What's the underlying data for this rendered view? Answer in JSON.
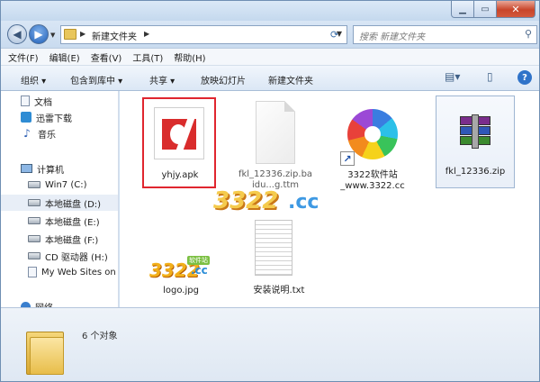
{
  "window": {
    "address_crumb": "新建文件夹",
    "search_placeholder": "搜索 新建文件夹"
  },
  "menu": [
    "文件(F)",
    "编辑(E)",
    "查看(V)",
    "工具(T)",
    "帮助(H)"
  ],
  "toolbar": {
    "organize": "组织 ▾",
    "include_library": "包含到库中 ▾",
    "share": "共享 ▾",
    "slideshow": "放映幻灯片",
    "new_folder": "新建文件夹"
  },
  "nav": {
    "items": [
      {
        "label": "文档",
        "icon": "document-icon"
      },
      {
        "label": "迅雷下载",
        "icon": "thunder-download-icon"
      },
      {
        "label": "音乐",
        "icon": "music-icon"
      },
      {
        "label": "计算机",
        "icon": "computer-icon"
      },
      {
        "label": "Win7 (C:)",
        "icon": "drive-icon"
      },
      {
        "label": "本地磁盘 (D:)",
        "icon": "drive-icon"
      },
      {
        "label": "本地磁盘 (E:)",
        "icon": "drive-icon"
      },
      {
        "label": "本地磁盘 (F:)",
        "icon": "drive-icon"
      },
      {
        "label": "CD 驱动器 (H:)",
        "icon": "cd-drive-icon"
      },
      {
        "label": "My Web Sites on",
        "icon": "web-folder-icon"
      },
      {
        "label": "网络",
        "icon": "network-icon"
      }
    ]
  },
  "files": [
    {
      "name": "yhjy.apk",
      "icon": "apk-file-icon"
    },
    {
      "name": "fkl_12336.zip.ba idu...g.ttm",
      "icon": "blank-file-icon"
    },
    {
      "name": "3322软件站_www.3322.cc",
      "icon": "pinwheel-shortcut-icon"
    },
    {
      "name": "fkl_12336.zip",
      "icon": "winrar-archive-icon"
    },
    {
      "name": "logo.jpg",
      "icon": "image-file-icon"
    },
    {
      "name": "安装说明.txt",
      "icon": "text-file-icon"
    }
  ],
  "logo": {
    "digits": "3322",
    "cc": ".cc",
    "badge": "软件站"
  },
  "watermark": {
    "digits": "3322",
    "cc": ".cc"
  },
  "details": {
    "count": "6 个对象"
  }
}
